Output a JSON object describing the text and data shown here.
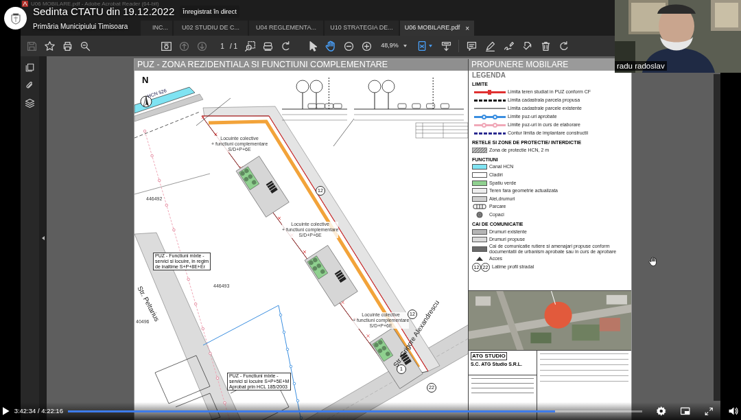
{
  "video": {
    "title": "Sedinta CTATU din 19.12.2022",
    "badge": "Înregistrat în direct",
    "channel": "Primăria Municipiului Timisoara",
    "participant": "radu radoslav",
    "player": {
      "time": "3:42:34 / 4:22:16",
      "level": 0.848
    }
  },
  "acrobat": {
    "window_title": "U06 MOBILARE.pdf - Adobe Acrobat Reader (64-bit)",
    "tabs": [
      {
        "label": "INC...",
        "selected": false
      },
      {
        "label": "U02 STUDIU DE C...",
        "selected": false
      },
      {
        "label": "U04 REGLEMENTA...",
        "selected": false
      },
      {
        "label": "U10 STRATEGIA DE...",
        "selected": false
      },
      {
        "label": "U06 MOBILARE.pdf",
        "selected": true,
        "close": "×"
      }
    ],
    "toolbar": {
      "page": "1",
      "page_total": "/ 1",
      "zoom": "48,9%",
      "tools": [
        {
          "kind": "select",
          "selected": false
        },
        {
          "kind": "hand",
          "selected": true
        }
      ]
    },
    "document": {
      "plan_title": "PUZ - ZONA REZIDENTIALA SI FUNCTIUNI COMPLEMENTARE",
      "north": "N",
      "sheet_title": "PROPUNERE MOBILARE",
      "map_labels": [
        {
          "kind": "note",
          "lines": [
            "Locuinte colective",
            "+ functiuni complementare",
            "S/D+P+6E"
          ]
        },
        {
          "kind": "note",
          "lines": [
            "Locuinte colective",
            "+ functiuni complementare",
            "S/D+P+6E"
          ]
        },
        {
          "kind": "note",
          "lines": [
            "Locuinte colective",
            "+ functiuni complementare",
            "S/D+P+6E"
          ]
        },
        {
          "kind": "boxed",
          "lines": [
            "PUZ - Functiuni mixte -",
            "servici si locuire, in regim",
            "de inaltime S+P+8E+Er"
          ]
        },
        {
          "kind": "boxed",
          "lines": [
            "PUZ - Functiuni mixte -",
            "servici si locuire S+P+5E+M",
            "Aprobat prin HCL 185/2003"
          ]
        },
        {
          "kind": "parcel",
          "lines": [
            "446492"
          ]
        },
        {
          "kind": "parcel",
          "lines": [
            "446493"
          ]
        },
        {
          "kind": "parcel",
          "lines": [
            "40496"
          ]
        },
        {
          "kind": "street",
          "lines": [
            "Str. Peltarius"
          ]
        },
        {
          "kind": "street",
          "lines": [
            "Str. Grigore Alexandrescu"
          ]
        },
        {
          "kind": "marker",
          "lines": [
            "12"
          ]
        },
        {
          "kind": "marker",
          "lines": [
            "12"
          ]
        },
        {
          "kind": "marker",
          "lines": [
            "1"
          ]
        },
        {
          "kind": "marker",
          "lines": [
            "22"
          ]
        },
        {
          "kind": "canal",
          "lines": [
            "HCN 526"
          ]
        }
      ],
      "legend": {
        "title": "LEGENDA",
        "sections": [
          {
            "title": "LIMITE",
            "items": [
              {
                "kind": "cross-line",
                "color": "#e03030",
                "label": "Limita teren studiat in PUZ conform CF"
              },
              {
                "kind": "dashed-line",
                "color": "#111111",
                "label": "Limita cadastrala parcela propusa"
              },
              {
                "kind": "thin-line",
                "color": "#8a8a8a",
                "label": "Limita cadastrale parcele existente"
              },
              {
                "kind": "ring-line",
                "color": "#3a8ee0",
                "label": "Limite puz-uri aprobate"
              },
              {
                "kind": "ring-line",
                "color": "#f0a8b8",
                "label": "Limite puz-uri in curs de elaborare"
              },
              {
                "kind": "dashed-line",
                "color": "#2a2a90",
                "label": "Contur limita de implantare constructii"
              }
            ]
          },
          {
            "title": "RETELE SI ZONE DE PROTECTIE/ INTERDICTIE",
            "items": [
              {
                "kind": "hatch",
                "label": "Zona de protectie HCN, 2 m"
              }
            ]
          },
          {
            "title": "FUNCTIUNI",
            "items": [
              {
                "kind": "swatch",
                "color": "#7fe3f2",
                "label": "Canal HCN"
              },
              {
                "kind": "swatch",
                "color": "#ffffff",
                "label": "Cladiri"
              },
              {
                "kind": "swatch",
                "color": "#8fd08f",
                "label": "Spatiu verde"
              },
              {
                "kind": "swatch",
                "color": "#ededed",
                "label": "Teren fara geometrie actualizata"
              },
              {
                "kind": "swatch",
                "color": "#cfcfcf",
                "label": "Alei,drumuri"
              },
              {
                "kind": "parking",
                "label": "Parcare"
              },
              {
                "kind": "tree",
                "label": "Copaci"
              }
            ]
          },
          {
            "title": "CAI DE COMUNICATIE",
            "items": [
              {
                "kind": "swatch",
                "color": "#b5b5b5",
                "label": "Drumuri existente"
              },
              {
                "kind": "swatch",
                "color": "#dadada",
                "label": "Drumuri propuse"
              },
              {
                "kind": "swatch",
                "color": "#6a6a6a",
                "label": "Cai de comunicatie rutiere si amenajari propuse conform documentatii de urbanism aprobate sau in curs de aprobare"
              },
              {
                "kind": "triangle",
                "label": "Acces"
              },
              {
                "kind": "profile",
                "marks": [
                  "12",
                  "22"
                ],
                "label": "Latime profil stradal"
              }
            ]
          }
        ]
      },
      "title_block": {
        "logo": "ATG STUDIO",
        "firm": "S.C. ATG Studio S.R.L."
      }
    }
  }
}
